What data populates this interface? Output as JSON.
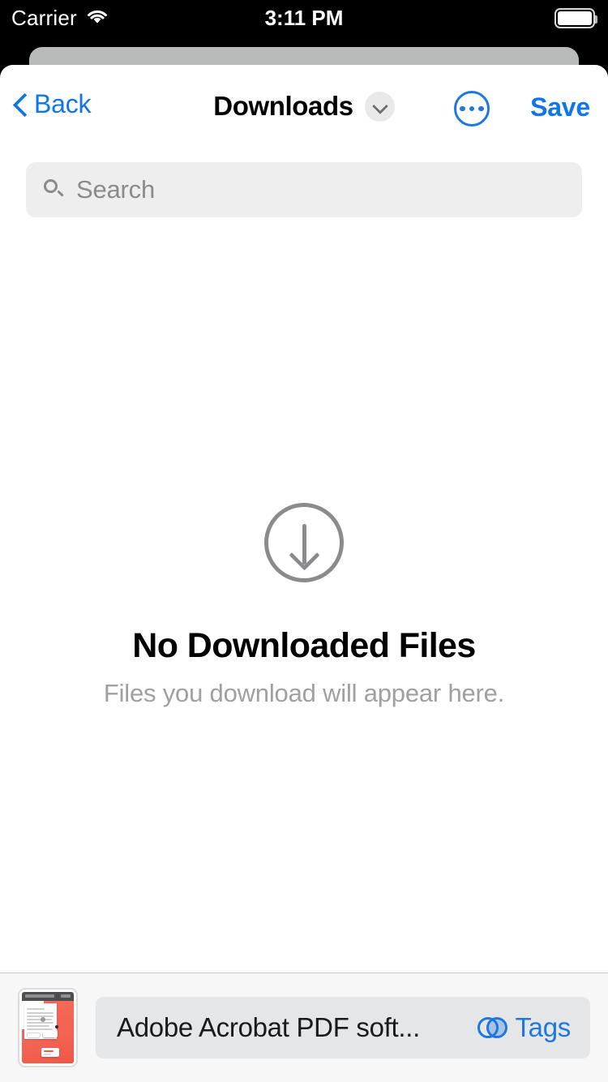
{
  "status_bar": {
    "carrier": "Carrier",
    "wifi_icon": "wifi-icon",
    "time": "3:11 PM",
    "battery_icon": "battery-icon"
  },
  "nav_bar": {
    "back_label": "Back",
    "back_icon": "chevron-left-icon",
    "title": "Downloads",
    "title_chevron_icon": "chevron-down-icon",
    "more_icon": "ellipsis-circle-icon",
    "save_label": "Save"
  },
  "search": {
    "icon": "search-icon",
    "placeholder": "Search",
    "value": ""
  },
  "empty_state": {
    "icon": "download-circle-icon",
    "title": "No Downloaded Files",
    "subtitle": "Files you download will appear here."
  },
  "bottom_bar": {
    "thumbnail_name": "document-thumbnail",
    "filename": "Adobe Acrobat PDF soft...",
    "tags_icon": "tags-circles-icon",
    "tags_label": "Tags"
  },
  "colors": {
    "accent_blue": "#1075e8",
    "icon_blue": "#1f78e0",
    "gray_text": "#8b8b8d",
    "subtitle_gray": "#a0a0a2",
    "search_bg": "#eeeeee",
    "bottom_bar_bg": "#f7f7f7",
    "name_field_bg": "#e4e6e7",
    "sheet_back": "#b9bbbb",
    "thumb_red": "#f05a4b"
  }
}
